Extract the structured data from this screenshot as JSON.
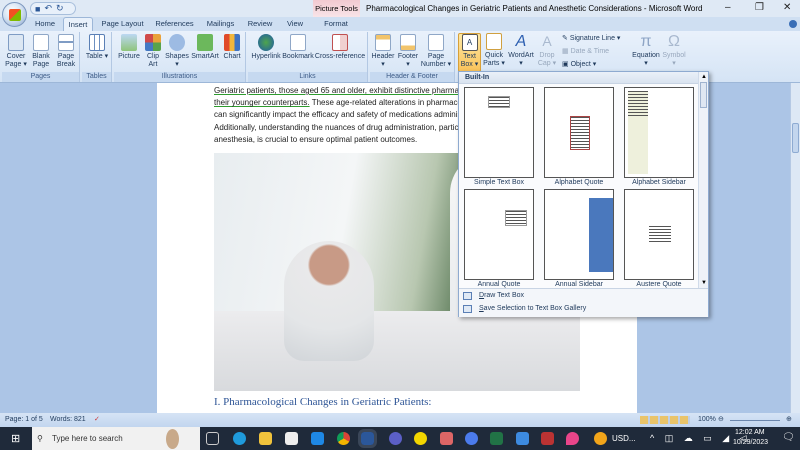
{
  "window": {
    "title": "Pharmacological Changes in Geriatric Patients and Anesthetic Considerations - Microsoft Word",
    "context_tab": "Picture Tools",
    "minimize": "–",
    "restore": "❐",
    "close": "✕"
  },
  "tabs": [
    "Home",
    "Insert",
    "Page Layout",
    "References",
    "Mailings",
    "Review",
    "View",
    "Format"
  ],
  "ribbon": {
    "groups": {
      "pages": "Pages",
      "tables": "Tables",
      "illustrations": "Illustrations",
      "links": "Links",
      "header_footer": "Header & Footer"
    },
    "buttons": {
      "cover_page": "Cover Page ▾",
      "blank_page": "Blank Page",
      "page_break": "Page Break",
      "table": "Table ▾",
      "picture": "Picture",
      "clip_art": "Clip Art",
      "shapes": "Shapes ▾",
      "smartart": "SmartArt",
      "chart": "Chart",
      "hyperlink": "Hyperlink",
      "bookmark": "Bookmark",
      "cross_reference": "Cross-reference",
      "header": "Header ▾",
      "footer": "Footer ▾",
      "page_number": "Page Number ▾",
      "text_box": "Text Box ▾",
      "quick_parts": "Quick Parts ▾",
      "wordart": "WordArt ▾",
      "drop_cap": "Drop Cap ▾",
      "signature_line": "Signature Line ▾",
      "date_time": "Date & Time",
      "object": "Object ▾",
      "equation": "Equation ▾",
      "symbol": "Symbol ▾"
    }
  },
  "document": {
    "lines": [
      [
        "Geriatric patients, those aged 65 and older, exhibit distinctive pharma",
        ""
      ],
      [
        "their younger counterparts.",
        " These age-related alterations in pharmacol"
      ],
      [
        "",
        "can significantly impact the efficacy and safety of medications adminis"
      ],
      [
        "",
        "Additionally, understanding the nuances of drug administration, partic"
      ],
      [
        "",
        "anesthesia, is crucial to ensure optimal patient outcomes."
      ]
    ],
    "heading": "I. Pharmacological Changes in Geriatric Patients:"
  },
  "gallery": {
    "header": "Built-In",
    "items": [
      "Simple Text Box",
      "Alphabet Quote",
      "Alphabet Sidebar",
      "Annual Quote",
      "Annual Sidebar",
      "Austere Quote"
    ],
    "draw": "Draw Text Box",
    "save": "Save Selection to Text Box Gallery"
  },
  "status": {
    "page": "Page: 1 of 5",
    "words": "Words: 821",
    "zoom": "100%"
  },
  "taskbar": {
    "search_placeholder": "Type here to search",
    "currency": "USD...",
    "time": "12:02 AM",
    "date": "10/29/2023"
  }
}
